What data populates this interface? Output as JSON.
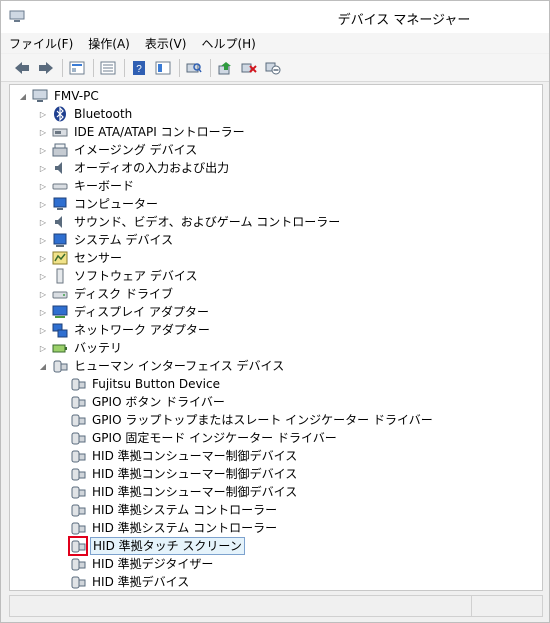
{
  "window": {
    "title": "デバイス マネージャー"
  },
  "menu": [
    "ファイル(F)",
    "操作(A)",
    "表示(V)",
    "ヘルプ(H)"
  ],
  "toolbar": [
    "back-icon",
    "forward-icon",
    "sep",
    "properties-icon",
    "sep",
    "view-icon",
    "sep",
    "help-icon",
    "view-toggle-icon",
    "sep",
    "scan-icon",
    "sep",
    "update-driver-icon",
    "uninstall-icon",
    "disable-icon"
  ],
  "tree": {
    "root": "FMV-PC",
    "categories": [
      {
        "label": "Bluetooth",
        "icon": "bluetooth-icon"
      },
      {
        "label": "IDE ATA/ATAPI コントローラー",
        "icon": "ide-controller-icon"
      },
      {
        "label": "イメージング デバイス",
        "icon": "imaging-device-icon"
      },
      {
        "label": "オーディオの入力および出力",
        "icon": "speaker-icon"
      },
      {
        "label": "キーボード",
        "icon": "keyboard-icon"
      },
      {
        "label": "コンピューター",
        "icon": "computer-icon"
      },
      {
        "label": "サウンド、ビデオ、およびゲーム コントローラー",
        "icon": "sound-icon"
      },
      {
        "label": "システム デバイス",
        "icon": "system-device-icon"
      },
      {
        "label": "センサー",
        "icon": "sensor-icon"
      },
      {
        "label": "ソフトウェア デバイス",
        "icon": "software-device-icon"
      },
      {
        "label": "ディスク ドライブ",
        "icon": "disk-drive-icon"
      },
      {
        "label": "ディスプレイ アダプター",
        "icon": "display-adapter-icon"
      },
      {
        "label": "ネットワーク アダプター",
        "icon": "network-adapter-icon"
      },
      {
        "label": "バッテリ",
        "icon": "battery-icon"
      },
      {
        "label": "ヒューマン インターフェイス デバイス",
        "icon": "hid-icon",
        "expanded": true
      }
    ],
    "hid_children": [
      "Fujitsu Button Device",
      "GPIO ボタン ドライバー",
      "GPIO ラップトップまたはスレート インジケーター ドライバー",
      "GPIO 固定モード インジケーター ドライバー",
      "HID 準拠コンシューマー制御デバイス",
      "HID 準拠コンシューマー制御デバイス",
      "HID 準拠コンシューマー制御デバイス",
      "HID 準拠システム コントローラー",
      "HID 準拠システム コントローラー",
      "HID 準拠タッチ スクリーン",
      "HID 準拠デジタイザー",
      "HID 準拠デバイス"
    ],
    "selected_child": "HID 準拠タッチ スクリーン"
  },
  "colors": {
    "highlight": "#e0001b",
    "selection_bg": "#e5f3fb",
    "selection_border": "#7da2ce"
  }
}
